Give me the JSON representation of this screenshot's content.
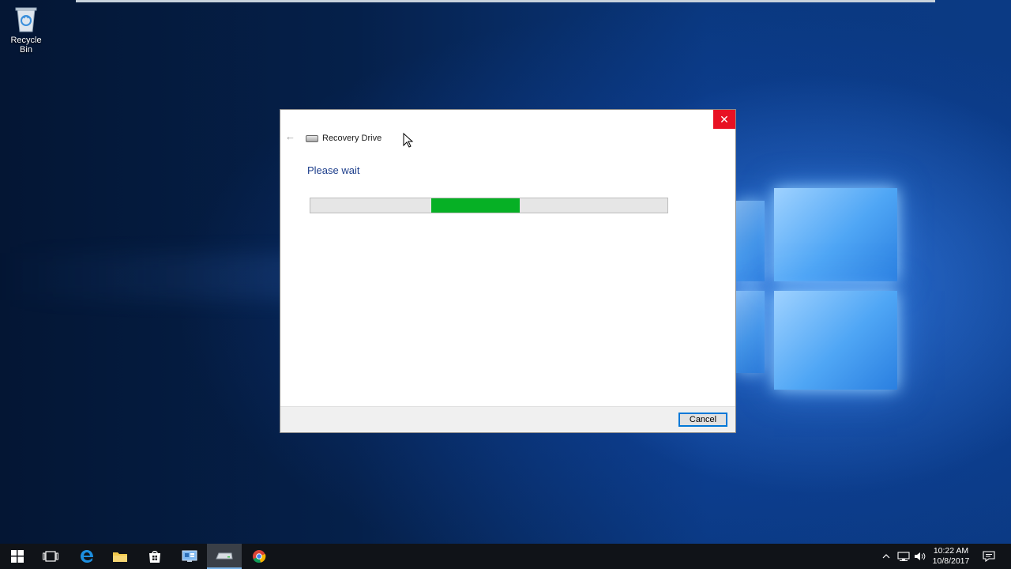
{
  "desktop": {
    "icons": [
      {
        "label": "Recycle Bin",
        "icon": "recycle-bin-icon"
      }
    ]
  },
  "dialog": {
    "title": "Recovery Drive",
    "heading": "Please wait",
    "progress_percent": 25,
    "buttons": {
      "cancel": "Cancel"
    },
    "close_glyph": "✕",
    "back_glyph": "←"
  },
  "taskbar": {
    "apps": [
      {
        "icon": "start-windows-icon"
      },
      {
        "icon": "task-view-icon"
      },
      {
        "icon": "edge-browser-icon"
      },
      {
        "icon": "file-explorer-icon"
      },
      {
        "icon": "store-icon"
      },
      {
        "icon": "control-panel-icon"
      },
      {
        "icon": "recovery-drive-icon",
        "active": true
      },
      {
        "icon": "chrome-icon"
      }
    ],
    "tray": {
      "time": "10:22 AM",
      "date": "10/8/2017",
      "chevron_glyph": "^"
    }
  },
  "colors": {
    "accent": "#0078d7",
    "close_red": "#e81123",
    "progress_green": "#06b025",
    "heading_blue": "#1e3f8c"
  }
}
